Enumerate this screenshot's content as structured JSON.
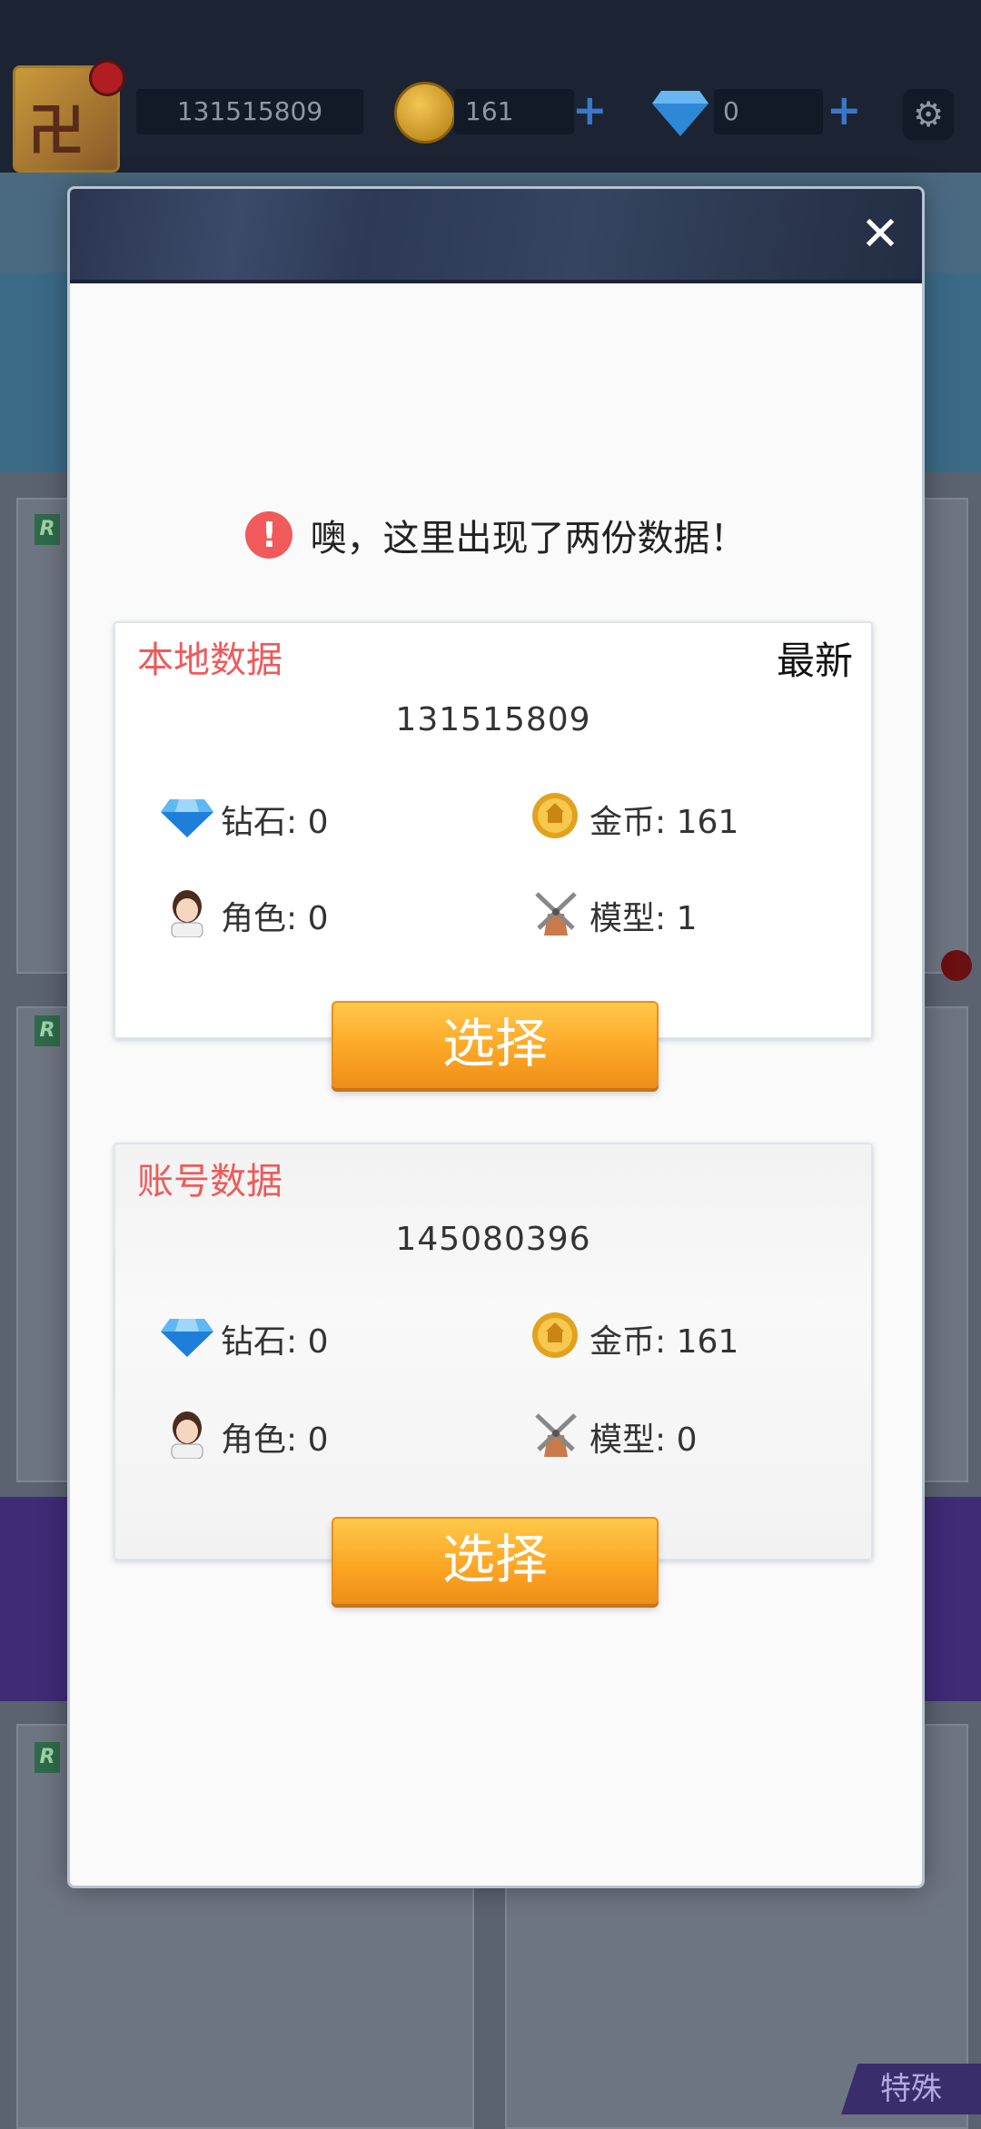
{
  "background": {
    "player_id": "131515809",
    "coins": "161",
    "gems": "0",
    "special_tab": "特殊"
  },
  "modal": {
    "notice": "噢，这里出现了两份数据！",
    "local": {
      "title": "本地数据",
      "tag": "最新",
      "id": "131515809",
      "gems": "钻石: 0",
      "coins": "金币: 161",
      "roles": "角色: 0",
      "models": "模型: 1",
      "select": "选择"
    },
    "account": {
      "title": "账号数据",
      "id": "145080396",
      "gems": "钻石: 0",
      "coins": "金币: 161",
      "roles": "角色: 0",
      "models": "模型: 0",
      "select": "选择"
    }
  },
  "colors": {
    "accent_red": "#ee5a5a",
    "button_orange": "#fca726",
    "header_navy": "#2a3550"
  }
}
